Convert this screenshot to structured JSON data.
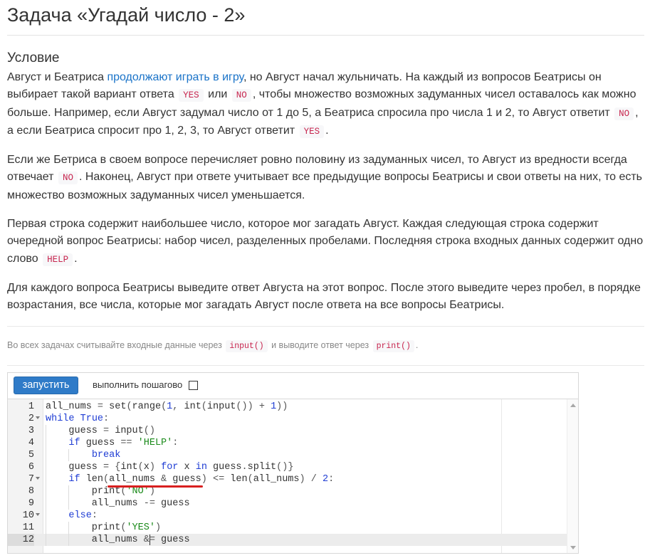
{
  "title": "Задача «Угадай число - 2»",
  "section_heading": "Условие",
  "paragraphs": {
    "p1_a": "Август и Беатриса ",
    "p1_link": "продолжают играть в игру",
    "p1_b": ", но Август начал жульничать. На каждый из вопросов Беатрисы он выбирает такой вариант ответа ",
    "p1_yes": "YES",
    "p1_c": " или ",
    "p1_no": "NO",
    "p1_d": ", чтобы множество возможных задуманных чисел оставалось как можно больше. Например, если Август задумал число от 1 до 5, а Беатриса спросила про числа 1 и 2, то Август ответит ",
    "p1_no2": "NO",
    "p1_e": ", а если Беатриса спросит про 1, 2, 3, то Август ответит ",
    "p1_yes2": "YES",
    "p1_f": ".",
    "p2_a": "Если же Бетриса в своем вопросе перечисляет ровно половину из задуманных чисел, то Август из вредности всегда отвечает ",
    "p2_no": "NO",
    "p2_b": ". Наконец, Август при ответе учитывает все предыдущие вопросы Беатрисы и свои ответы на них, то есть множество возможных задуманных чисел уменьшается.",
    "p3_a": "Первая строка содержит наибольшее число, которое мог загадать Август. Каждая следующая строка содержит очередной вопрос Беатрисы: набор чисел, разделенных пробелами. Последняя строка входных данных содержит одно слово ",
    "p3_help": "HELP",
    "p3_b": ".",
    "p4": "Для каждого вопроса Беатрисы выведите ответ Августа на этот вопрос. После этого выведите через пробел, в порядке возрастания, все числа, которые мог загадать Август после ответа на все вопросы Беатрисы."
  },
  "note": {
    "a": "Во всех задачах считывайте входные данные через ",
    "input_code": "input()",
    "b": " и выводите ответ через ",
    "print_code": "print()",
    "c": "."
  },
  "editor": {
    "run_label": "запустить",
    "step_label": "выполнить пошагово",
    "step_checked": false,
    "active_line": 12,
    "line_numbers": [
      "1",
      "2",
      "3",
      "4",
      "5",
      "6",
      "7",
      "8",
      "9",
      "10",
      "11",
      "12"
    ],
    "folds": [
      2,
      7,
      10
    ],
    "code_lines": [
      "all_nums = set(range(1, int(input()) + 1))",
      "while True:",
      "    guess = input()",
      "    if guess == 'HELP':",
      "        break",
      "    guess = {int(x) for x in guess.split()}",
      "    if len(all_nums & guess) <= len(all_nums) / 2:",
      "        print('NO')",
      "        all_nums -= guess",
      "    else:",
      "        print('YES')",
      "        all_nums &= guess"
    ],
    "underline_line": 7,
    "underline_text": "all_nums & guess",
    "accent_color": "#2f7bc8",
    "underline_color": "#d81f1f"
  }
}
